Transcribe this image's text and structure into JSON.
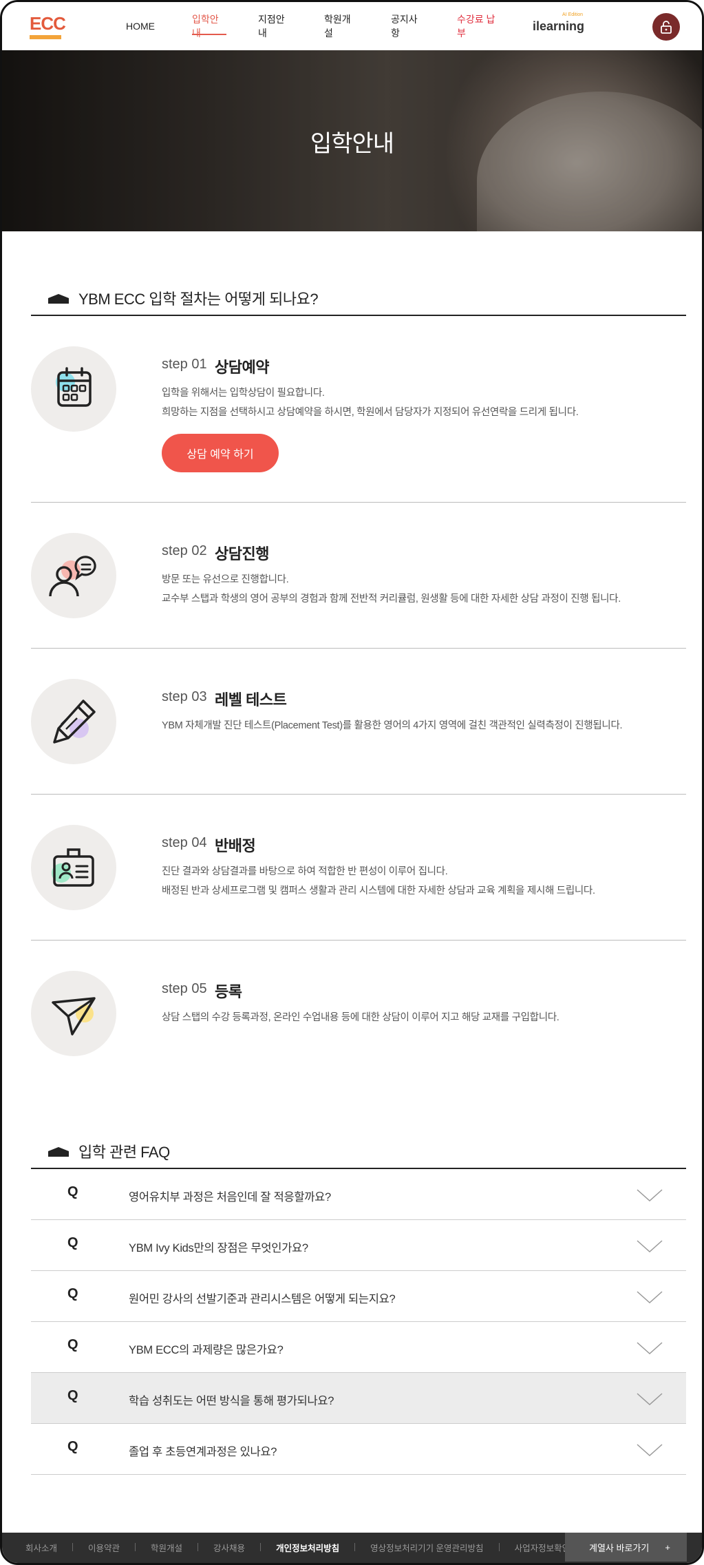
{
  "header": {
    "logo": "ECC",
    "nav": [
      "HOME",
      "입학안내",
      "지점안내",
      "학원개설",
      "공지사항",
      "수강료 납부"
    ],
    "ilearning": {
      "text": "ilearning",
      "badge": "AI Edition"
    }
  },
  "hero": {
    "title": "입학안내"
  },
  "procedure": {
    "title": "YBM ECC 입학 절차는 어떻게 되나요?",
    "steps": [
      {
        "no": "step 01",
        "title": "상담예약",
        "lines": [
          "입학을 위해서는 입학상담이 필요합니다.",
          "희망하는 지점을 선택하시고 상담예약을 하시면, 학원에서 담당자가 지정되어 유선연락을 드리게 됩니다."
        ],
        "button": "상담 예약 하기"
      },
      {
        "no": "step 02",
        "title": "상담진행",
        "lines": [
          "방문 또는 유선으로 진행합니다.",
          "교수부 스탭과 학생의 영어 공부의 경험과 함께 전반적 커리큘럼, 원생활 등에 대한 자세한 상담 과정이 진행 됩니다."
        ]
      },
      {
        "no": "step 03",
        "title": "레벨 테스트",
        "lines": [
          "YBM 자체개발 진단 테스트(Placement Test)를 활용한 영어의 4가지 영역에 걸친 객관적인 실력측정이 진행됩니다."
        ]
      },
      {
        "no": "step 04",
        "title": "반배정",
        "lines": [
          "진단 결과와 상담결과를 바탕으로 하여 적합한 반 편성이 이루어 집니다.",
          "배정된 반과 상세프로그램 및 캠퍼스 생활과 관리 시스템에 대한 자세한 상담과 교육 계획을 제시해 드립니다."
        ]
      },
      {
        "no": "step 05",
        "title": "등록",
        "lines": [
          "상담 스탭의 수강 등록과정, 온라인 수업내용 등에 대한 상담이 이루어 지고 해당 교재를 구입합니다."
        ]
      }
    ]
  },
  "faq": {
    "title": "입학 관련 FAQ",
    "q_label": "Q",
    "items": [
      "영어유치부 과정은 처음인데 잘 적응할까요?",
      "YBM Ivy Kids만의 장점은 무엇인가요?",
      "원어민 강사의 선발기준과 관리시스템은 어떻게 되는지요?",
      "YBM ECC의 과제량은 많은가요?",
      "학습 성취도는 어떤 방식을 통해 평가되나요?",
      "졸업 후 초등연계과정은 있나요?"
    ]
  },
  "footer": {
    "links": [
      "회사소개",
      "이용약관",
      "학원개설",
      "강사채용",
      "개인정보처리방침",
      "영상정보처리기기 운영관리방침",
      "사업자정보확인"
    ],
    "family": "계열사 바로가기",
    "family_plus": "+"
  },
  "colors": {
    "accent": "#f0554b",
    "footer": "#2f2f2f",
    "pay": "#e0303f"
  }
}
